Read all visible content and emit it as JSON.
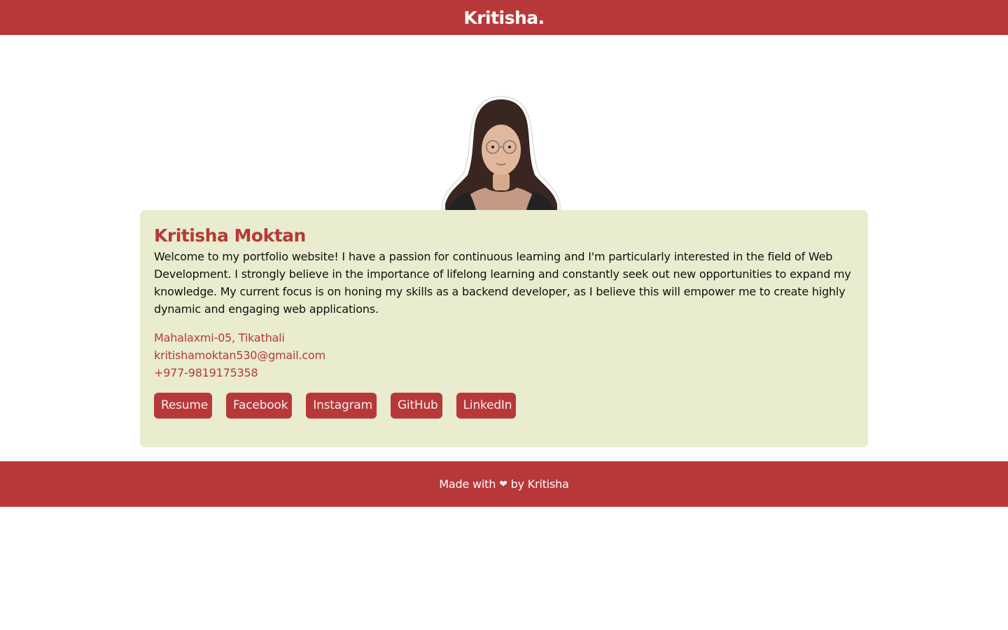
{
  "header": {
    "brand": "Kritisha."
  },
  "profile": {
    "photo_alt": "Kritisha Moktan portrait",
    "name": "Kritisha Moktan",
    "bio": "Welcome to my portfolio website! I have a passion for continuous learning and I'm particularly interested in the field of Web Development. I strongly believe in the importance of lifelong learning and constantly seek out new opportunities to expand my knowledge. My current focus is on honing my skills as a backend developer, as I believe this will empower me to create highly dynamic and engaging web applications.",
    "address": "Mahalaxmi-05, Tikathali",
    "email": "kritishamoktan530@gmail.com",
    "phone": "+977-9819175358"
  },
  "links": [
    {
      "label": "Resume"
    },
    {
      "label": "Facebook"
    },
    {
      "label": "Instagram"
    },
    {
      "label": "GitHub"
    },
    {
      "label": "LinkedIn"
    }
  ],
  "footer": {
    "made_with": "Made with",
    "heart": "❤",
    "by": "by Kritisha"
  },
  "colors": {
    "brand": "#b8383a",
    "card_bg": "#e9ecce",
    "text": "#111111"
  }
}
